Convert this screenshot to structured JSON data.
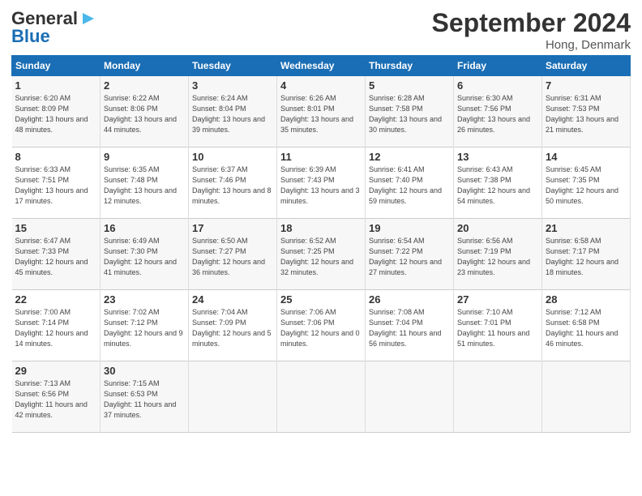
{
  "logo": {
    "line1": "General",
    "line2": "Blue"
  },
  "title": "September 2024",
  "location": "Hong, Denmark",
  "headers": [
    "Sunday",
    "Monday",
    "Tuesday",
    "Wednesday",
    "Thursday",
    "Friday",
    "Saturday"
  ],
  "weeks": [
    [
      {
        "day": 1,
        "rise": "6:20 AM",
        "set": "8:09 PM",
        "daylight": "13 hours and 48 minutes."
      },
      {
        "day": 2,
        "rise": "6:22 AM",
        "set": "8:06 PM",
        "daylight": "13 hours and 44 minutes."
      },
      {
        "day": 3,
        "rise": "6:24 AM",
        "set": "8:04 PM",
        "daylight": "13 hours and 39 minutes."
      },
      {
        "day": 4,
        "rise": "6:26 AM",
        "set": "8:01 PM",
        "daylight": "13 hours and 35 minutes."
      },
      {
        "day": 5,
        "rise": "6:28 AM",
        "set": "7:58 PM",
        "daylight": "13 hours and 30 minutes."
      },
      {
        "day": 6,
        "rise": "6:30 AM",
        "set": "7:56 PM",
        "daylight": "13 hours and 26 minutes."
      },
      {
        "day": 7,
        "rise": "6:31 AM",
        "set": "7:53 PM",
        "daylight": "13 hours and 21 minutes."
      }
    ],
    [
      {
        "day": 8,
        "rise": "6:33 AM",
        "set": "7:51 PM",
        "daylight": "13 hours and 17 minutes."
      },
      {
        "day": 9,
        "rise": "6:35 AM",
        "set": "7:48 PM",
        "daylight": "13 hours and 12 minutes."
      },
      {
        "day": 10,
        "rise": "6:37 AM",
        "set": "7:46 PM",
        "daylight": "13 hours and 8 minutes."
      },
      {
        "day": 11,
        "rise": "6:39 AM",
        "set": "7:43 PM",
        "daylight": "13 hours and 3 minutes."
      },
      {
        "day": 12,
        "rise": "6:41 AM",
        "set": "7:40 PM",
        "daylight": "12 hours and 59 minutes."
      },
      {
        "day": 13,
        "rise": "6:43 AM",
        "set": "7:38 PM",
        "daylight": "12 hours and 54 minutes."
      },
      {
        "day": 14,
        "rise": "6:45 AM",
        "set": "7:35 PM",
        "daylight": "12 hours and 50 minutes."
      }
    ],
    [
      {
        "day": 15,
        "rise": "6:47 AM",
        "set": "7:33 PM",
        "daylight": "12 hours and 45 minutes."
      },
      {
        "day": 16,
        "rise": "6:49 AM",
        "set": "7:30 PM",
        "daylight": "12 hours and 41 minutes."
      },
      {
        "day": 17,
        "rise": "6:50 AM",
        "set": "7:27 PM",
        "daylight": "12 hours and 36 minutes."
      },
      {
        "day": 18,
        "rise": "6:52 AM",
        "set": "7:25 PM",
        "daylight": "12 hours and 32 minutes."
      },
      {
        "day": 19,
        "rise": "6:54 AM",
        "set": "7:22 PM",
        "daylight": "12 hours and 27 minutes."
      },
      {
        "day": 20,
        "rise": "6:56 AM",
        "set": "7:19 PM",
        "daylight": "12 hours and 23 minutes."
      },
      {
        "day": 21,
        "rise": "6:58 AM",
        "set": "7:17 PM",
        "daylight": "12 hours and 18 minutes."
      }
    ],
    [
      {
        "day": 22,
        "rise": "7:00 AM",
        "set": "7:14 PM",
        "daylight": "12 hours and 14 minutes."
      },
      {
        "day": 23,
        "rise": "7:02 AM",
        "set": "7:12 PM",
        "daylight": "12 hours and 9 minutes."
      },
      {
        "day": 24,
        "rise": "7:04 AM",
        "set": "7:09 PM",
        "daylight": "12 hours and 5 minutes."
      },
      {
        "day": 25,
        "rise": "7:06 AM",
        "set": "7:06 PM",
        "daylight": "12 hours and 0 minutes."
      },
      {
        "day": 26,
        "rise": "7:08 AM",
        "set": "7:04 PM",
        "daylight": "11 hours and 56 minutes."
      },
      {
        "day": 27,
        "rise": "7:10 AM",
        "set": "7:01 PM",
        "daylight": "11 hours and 51 minutes."
      },
      {
        "day": 28,
        "rise": "7:12 AM",
        "set": "6:58 PM",
        "daylight": "11 hours and 46 minutes."
      }
    ],
    [
      {
        "day": 29,
        "rise": "7:13 AM",
        "set": "6:56 PM",
        "daylight": "11 hours and 42 minutes."
      },
      {
        "day": 30,
        "rise": "7:15 AM",
        "set": "6:53 PM",
        "daylight": "11 hours and 37 minutes."
      },
      null,
      null,
      null,
      null,
      null
    ]
  ]
}
